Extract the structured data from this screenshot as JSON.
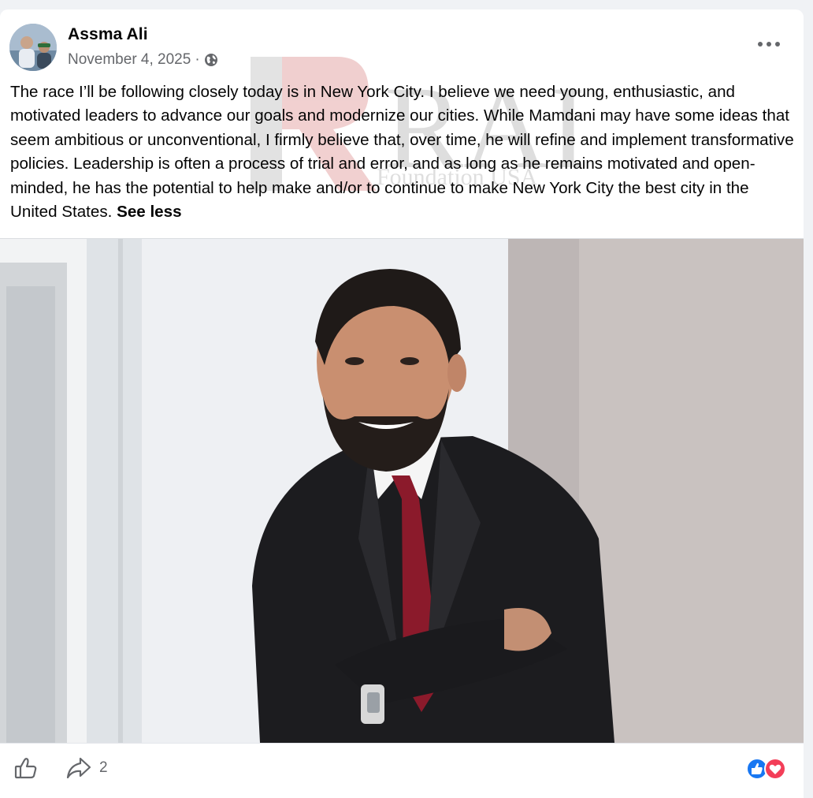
{
  "post": {
    "author": "Assma Ali",
    "date": "November 4, 2025",
    "separator": "·",
    "privacy_icon": "globe-icon",
    "text": "The race I’ll be following closely today is in New York City. I believe we need young, enthusiastic, and motivated leaders to advance our goals and modernize our cities. While Mamdani may have some ideas that seem ambitious or unconventional, I firmly believe that, over time, he will refine and implement transformative policies. Leadership is often a process of trial and error, and as long as he remains motivated and open-minded, he has the potential to help make and/or to continue to make New York City the best city in the United States.",
    "see_less": "See less",
    "watermark": "RAIR",
    "watermark_sub": "Foundation USA"
  },
  "actions": {
    "like_icon": "thumbs-up-icon",
    "share_icon": "share-arrow-icon",
    "share_count": "2",
    "reaction_icons": [
      "like-reaction-icon",
      "love-reaction-icon"
    ]
  },
  "colors": {
    "like_blue": "#1877f2",
    "love_red": "#f33e58",
    "secondary_text": "#65676b"
  }
}
